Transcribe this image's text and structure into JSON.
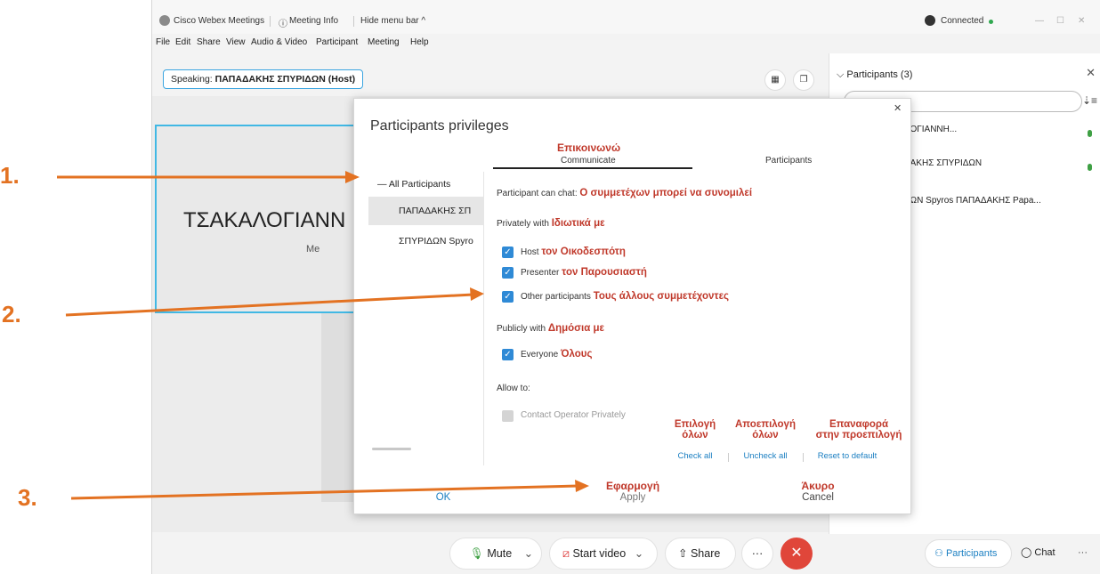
{
  "titlebar": {
    "app_title": "Cisco Webex Meetings",
    "meeting_info": "Meeting Info",
    "hide_menu": "Hide menu bar ^",
    "connected": "Connected",
    "connected_color": "#2fa84f"
  },
  "menubar": {
    "items": [
      "File",
      "Edit",
      "Share",
      "View",
      "Audio & Video",
      "Participant",
      "Meeting",
      "Help"
    ]
  },
  "speaking": {
    "prefix": "Speaking:",
    "name": "ΠΑΠΑΔΑΚΗΣ ΣΠΥΡΙΔΩΝ (Host)"
  },
  "videos": {
    "main_name": "ΤΣΑΚΑΛΟΓΙΑΝΝ",
    "main_sub": "Me"
  },
  "participants_panel": {
    "title": "Participants (3)",
    "rows": [
      "ΛΟΓΙΑΝΝΗ...",
      "ΔΑΚΗΣ ΣΠΥΡΙΔΩΝ",
      "ΔΩΝ Spyros ΠΑΠΑΔΑΚΗΣ Papa..."
    ]
  },
  "dialog": {
    "title": "Participants privileges",
    "left_items": [
      "All Participants",
      "ΠΑΠΑΔΑΚΗΣ ΣΠ",
      "ΣΠΥΡΙΔΩΝ Spyro"
    ],
    "tabs": {
      "communicate_gr": "Επικοινωνώ",
      "communicate": "Communicate",
      "participants": "Participants"
    },
    "can_chat": {
      "label": "Participant can chat:",
      "gr": "Ο συμμετέχων μπορεί να συνομιλεί"
    },
    "privately": {
      "label": "Privately with",
      "gr": "Ιδιωτικά με"
    },
    "options": [
      {
        "label": "Host",
        "gr": "τον Οικοδεσπότη",
        "checked": true
      },
      {
        "label": "Presenter",
        "gr": "τον Παρουσιαστή",
        "checked": true
      },
      {
        "label": "Other participants",
        "gr": "Τους άλλους συμμετέχοντες",
        "checked": true
      }
    ],
    "publicly": {
      "label": "Publicly with",
      "gr": "Δημόσια με"
    },
    "everyone": {
      "label": "Everyone",
      "gr": "Όλους",
      "checked": true
    },
    "allow_to": "Allow to:",
    "contact_operator": {
      "label": "Contact Operator Privately",
      "checked": false
    },
    "links": {
      "check_all_gr1": "Επιλογή",
      "check_all_gr2": "όλων",
      "check_all": "Check all",
      "uncheck_all_gr1": "Αποεπιλογή",
      "uncheck_all_gr2": "όλων",
      "uncheck_all": "Uncheck all",
      "reset_gr1": "Επαναφορά",
      "reset_gr2": "στην προεπιλογή",
      "reset": "Reset to default"
    },
    "buttons": {
      "ok": "OK",
      "apply_gr": "Εφαρμογή",
      "apply": "Apply",
      "cancel_gr": "Άκυρο",
      "cancel": "Cancel"
    }
  },
  "bottombar": {
    "mute": "Mute",
    "start_video": "Start video",
    "share": "Share",
    "more": "···",
    "participants": "Participants",
    "chat": "Chat"
  },
  "annotations": {
    "n1": "1.",
    "n2": "2.",
    "n3": "3.",
    "arrow_color": "#e37222"
  }
}
